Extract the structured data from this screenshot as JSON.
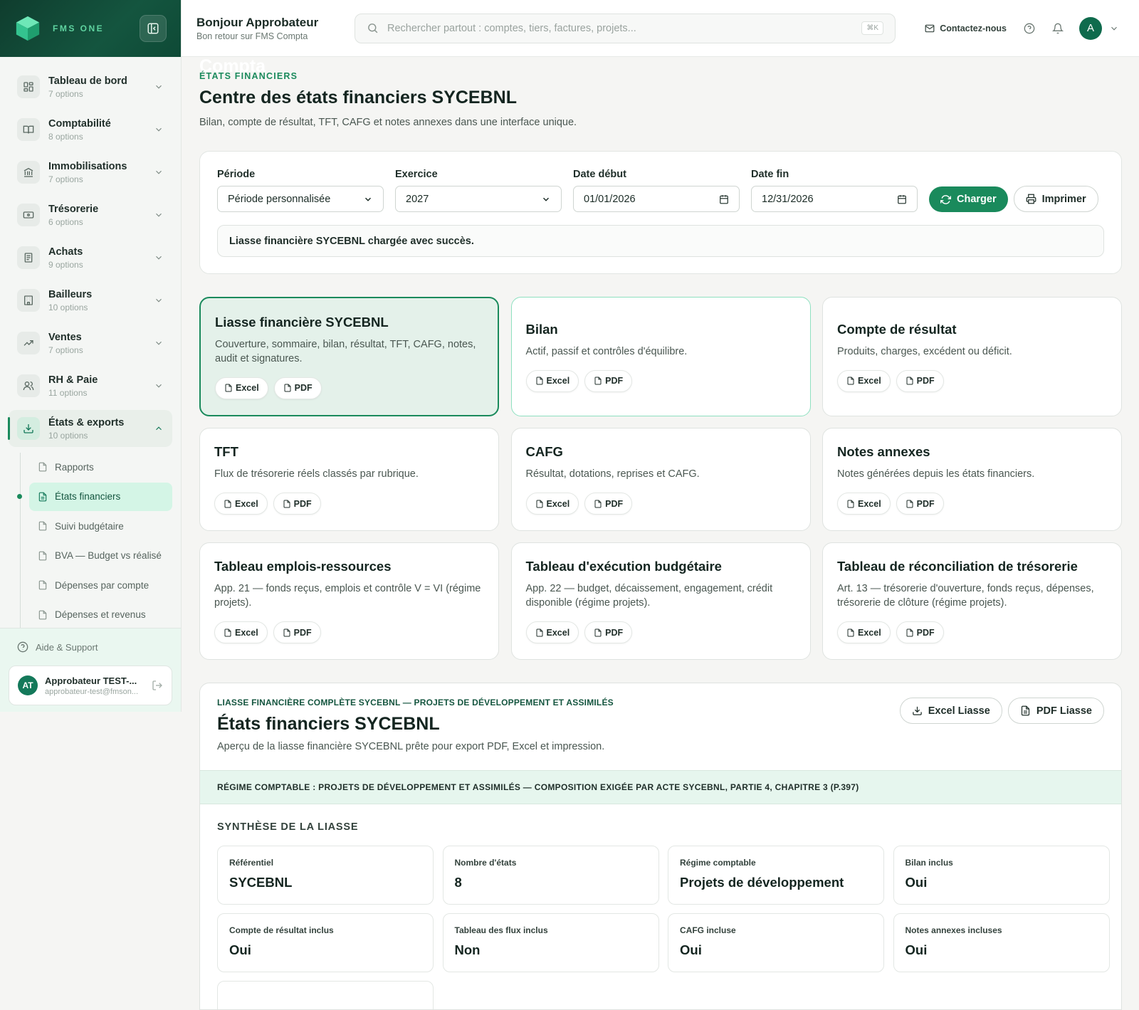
{
  "brand": {
    "sup": "FMS ONE",
    "name": "Compta"
  },
  "sidebar": {
    "items": [
      {
        "label": "Tableau de bord",
        "count": "7 options",
        "icon": "dashboard-icon"
      },
      {
        "label": "Comptabilité",
        "count": "8 options",
        "icon": "book-icon"
      },
      {
        "label": "Immobilisations",
        "count": "7 options",
        "icon": "bank-icon"
      },
      {
        "label": "Trésorerie",
        "count": "6 options",
        "icon": "cash-icon"
      },
      {
        "label": "Achats",
        "count": "9 options",
        "icon": "receipt-icon"
      },
      {
        "label": "Bailleurs",
        "count": "10 options",
        "icon": "building-icon"
      },
      {
        "label": "Ventes",
        "count": "7 options",
        "icon": "trend-icon"
      },
      {
        "label": "RH & Paie",
        "count": "11 options",
        "icon": "users-icon"
      },
      {
        "label": "États & exports",
        "count": "10 options",
        "icon": "download-icon"
      }
    ],
    "subitems": [
      "Rapports",
      "États financiers",
      "Suivi budgétaire",
      "BVA — Budget vs réalisé",
      "Dépenses par compte",
      "Dépenses et revenus"
    ],
    "help": "Aide & Support",
    "user": {
      "initials": "AT",
      "name": "Approbateur TEST-...",
      "email": "approbateur-test@fmson..."
    }
  },
  "header": {
    "greeting": "Bonjour Approbateur",
    "subtitle": "Bon retour sur FMS Compta",
    "search_placeholder": "Rechercher partout : comptes, tiers, factures, projets...",
    "shortcut": "⌘K",
    "contact": "Contactez-nous",
    "avatar": "A"
  },
  "page": {
    "kicker": "ÉTATS FINANCIERS",
    "title": "Centre des états financiers SYCEBNL",
    "description": "Bilan, compte de résultat, TFT, CAFG et notes annexes dans une interface unique."
  },
  "filters": {
    "periode_label": "Période",
    "periode_value": "Période personnalisée",
    "exercice_label": "Exercice",
    "exercice_value": "2027",
    "debut_label": "Date début",
    "debut_value": "01/01/2026",
    "fin_label": "Date fin",
    "fin_value": "12/31/2026",
    "load": "Charger",
    "print": "Imprimer",
    "message": "Liasse financière SYCEBNL chargée avec succès."
  },
  "cards": [
    {
      "title": "Liasse financière SYCEBNL",
      "desc": "Couverture, sommaire, bilan, résultat, TFT, CAFG, notes, audit et signatures."
    },
    {
      "title": "Bilan",
      "desc": "Actif, passif et contrôles d'équilibre."
    },
    {
      "title": "Compte de résultat",
      "desc": "Produits, charges, excédent ou déficit."
    },
    {
      "title": "TFT",
      "desc": "Flux de trésorerie réels classés par rubrique."
    },
    {
      "title": "CAFG",
      "desc": "Résultat, dotations, reprises et CAFG."
    },
    {
      "title": "Notes annexes",
      "desc": "Notes générées depuis les états financiers."
    },
    {
      "title": "Tableau emplois-ressources",
      "desc": "App. 21 — fonds reçus, emplois et contrôle V = VI (régime projets)."
    },
    {
      "title": "Tableau d'exécution budgétaire",
      "desc": "App. 22 — budget, décaissement, engagement, crédit disponible (régime projets)."
    },
    {
      "title": "Tableau de réconciliation de trésorerie",
      "desc": "Art. 13 — trésorerie d'ouverture, fonds reçus, dépenses, trésorerie de clôture (régime projets)."
    }
  ],
  "chips": {
    "excel": "Excel",
    "pdf": "PDF"
  },
  "liasse": {
    "kicker": "LIASSE FINANCIÈRE COMPLÈTE SYCEBNL — PROJETS DE DÉVELOPPEMENT ET ASSIMILÉS",
    "title": "États financiers SYCEBNL",
    "desc": "Aperçu de la liasse financière SYCEBNL prête pour export PDF, Excel et impression.",
    "excel_btn": "Excel Liasse",
    "pdf_btn": "PDF Liasse",
    "regime": "RÉGIME COMPTABLE : PROJETS DE DÉVELOPPEMENT ET ASSIMILÉS — COMPOSITION EXIGÉE PAR ACTE SYCEBNL, PARTIE 4, CHAPITRE 3 (P.397)",
    "synth_title": "SYNTHÈSE DE LA LIASSE",
    "synth": [
      {
        "label": "Référentiel",
        "value": "SYCEBNL"
      },
      {
        "label": "Nombre d'états",
        "value": "8"
      },
      {
        "label": "Régime comptable",
        "value": "Projets de développement"
      },
      {
        "label": "Bilan inclus",
        "value": "Oui"
      },
      {
        "label": "Compte de résultat inclus",
        "value": "Oui"
      },
      {
        "label": "Tableau des flux inclus",
        "value": "Non"
      },
      {
        "label": "CAFG incluse",
        "value": "Oui"
      },
      {
        "label": "Notes annexes incluses",
        "value": "Oui"
      }
    ]
  }
}
